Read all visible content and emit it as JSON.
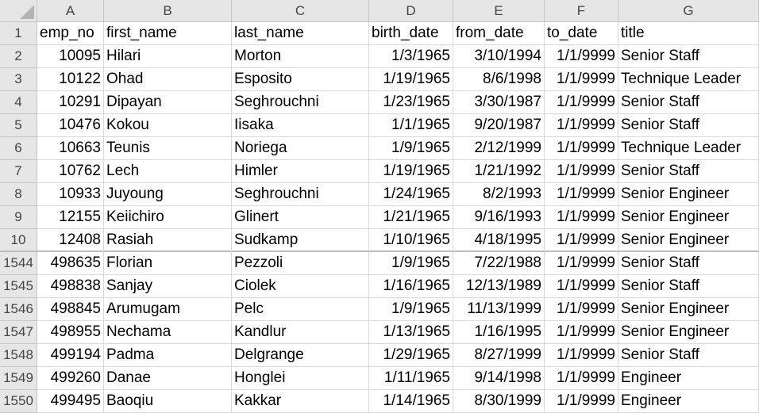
{
  "columns": [
    "A",
    "B",
    "C",
    "D",
    "E",
    "F",
    "G"
  ],
  "rows": [
    {
      "n": "1",
      "cells": [
        "emp_no",
        "first_name",
        "last_name",
        "birth_date",
        "from_date",
        "to_date",
        "title"
      ]
    },
    {
      "n": "2",
      "cells": [
        "10095",
        "Hilari",
        "Morton",
        "1/3/1965",
        "3/10/1994",
        "1/1/9999",
        "Senior Staff"
      ]
    },
    {
      "n": "3",
      "cells": [
        "10122",
        "Ohad",
        "Esposito",
        "1/19/1965",
        "8/6/1998",
        "1/1/9999",
        "Technique Leader"
      ]
    },
    {
      "n": "4",
      "cells": [
        "10291",
        "Dipayan",
        "Seghrouchni",
        "1/23/1965",
        "3/30/1987",
        "1/1/9999",
        "Senior Staff"
      ]
    },
    {
      "n": "5",
      "cells": [
        "10476",
        "Kokou",
        "Iisaka",
        "1/1/1965",
        "9/20/1987",
        "1/1/9999",
        "Senior Staff"
      ]
    },
    {
      "n": "6",
      "cells": [
        "10663",
        "Teunis",
        "Noriega",
        "1/9/1965",
        "2/12/1999",
        "1/1/9999",
        "Technique Leader"
      ]
    },
    {
      "n": "7",
      "cells": [
        "10762",
        "Lech",
        "Himler",
        "1/19/1965",
        "1/21/1992",
        "1/1/9999",
        "Senior Staff"
      ]
    },
    {
      "n": "8",
      "cells": [
        "10933",
        "Juyoung",
        "Seghrouchni",
        "1/24/1965",
        "8/2/1993",
        "1/1/9999",
        "Senior Engineer"
      ]
    },
    {
      "n": "9",
      "cells": [
        "12155",
        "Keiichiro",
        "Glinert",
        "1/21/1965",
        "9/16/1993",
        "1/1/9999",
        "Senior Engineer"
      ]
    },
    {
      "n": "10",
      "cells": [
        "12408",
        "Rasiah",
        "Sudkamp",
        "1/10/1965",
        "4/18/1995",
        "1/1/9999",
        "Senior Engineer"
      ]
    },
    {
      "n": "1544",
      "cells": [
        "498635",
        "Florian",
        "Pezzoli",
        "1/9/1965",
        "7/22/1988",
        "1/1/9999",
        "Senior Staff"
      ]
    },
    {
      "n": "1545",
      "cells": [
        "498838",
        "Sanjay",
        "Ciolek",
        "1/16/1965",
        "12/13/1989",
        "1/1/9999",
        "Senior Staff"
      ]
    },
    {
      "n": "1546",
      "cells": [
        "498845",
        "Arumugam",
        "Pelc",
        "1/9/1965",
        "11/13/1999",
        "1/1/9999",
        "Senior Engineer"
      ]
    },
    {
      "n": "1547",
      "cells": [
        "498955",
        "Nechama",
        "Kandlur",
        "1/13/1965",
        "1/16/1995",
        "1/1/9999",
        "Senior Engineer"
      ]
    },
    {
      "n": "1548",
      "cells": [
        "499194",
        "Padma",
        "Delgrange",
        "1/29/1965",
        "8/27/1999",
        "1/1/9999",
        "Senior Staff"
      ]
    },
    {
      "n": "1549",
      "cells": [
        "499260",
        "Danae",
        "Honglei",
        "1/11/1965",
        "9/14/1998",
        "1/1/9999",
        "Engineer"
      ]
    },
    {
      "n": "1550",
      "cells": [
        "499495",
        "Baoqiu",
        "Kakkar",
        "1/14/1965",
        "8/30/1999",
        "1/1/9999",
        "Engineer"
      ]
    }
  ]
}
